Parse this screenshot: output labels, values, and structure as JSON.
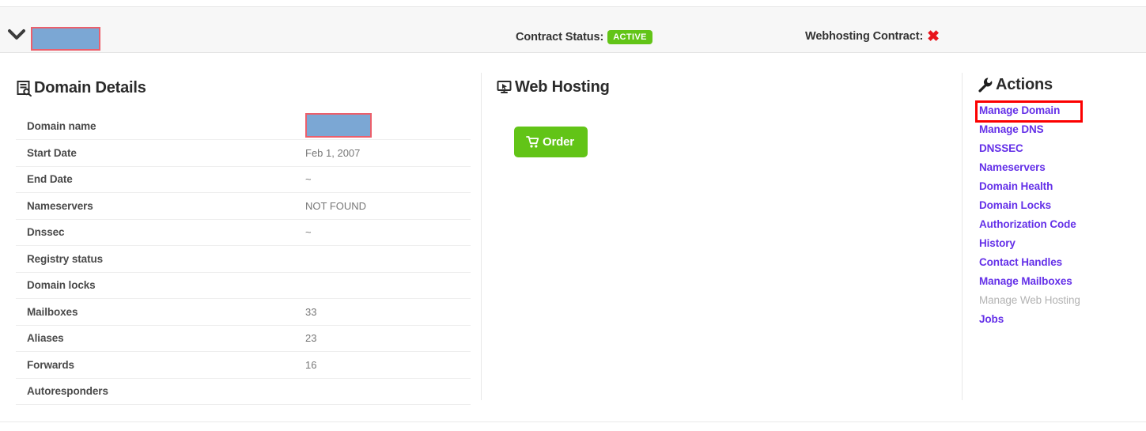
{
  "header": {
    "collapse_icon": "chevron-down-icon",
    "redacted_title": "",
    "contract_status_label": "Contract Status:",
    "contract_status_value": "ACTIVE",
    "webhosting_contract_label": "Webhosting Contract:",
    "webhosting_contract_value": "✖",
    "badge_color": "#62c417",
    "x_color": "#e8131a"
  },
  "domain_details": {
    "icon": "document-search-icon",
    "title": "Domain Details",
    "rows": [
      {
        "label": "Domain name",
        "value": "",
        "redacted": true
      },
      {
        "label": "Start Date",
        "value": "Feb 1, 2007",
        "redacted": false
      },
      {
        "label": "End Date",
        "value": "~",
        "redacted": false
      },
      {
        "label": "Nameservers",
        "value": "NOT FOUND",
        "redacted": false
      },
      {
        "label": "Dnssec",
        "value": "~",
        "redacted": false
      },
      {
        "label": "Registry status",
        "value": "",
        "redacted": false
      },
      {
        "label": "Domain locks",
        "value": "",
        "redacted": false
      },
      {
        "label": "Mailboxes",
        "value": "33",
        "redacted": false
      },
      {
        "label": "Aliases",
        "value": "23",
        "redacted": false
      },
      {
        "label": "Forwards",
        "value": "16",
        "redacted": false
      },
      {
        "label": "Autoresponders",
        "value": "",
        "redacted": false
      }
    ]
  },
  "web_hosting": {
    "icon": "monitor-cursor-icon",
    "title": "Web Hosting",
    "order_button": {
      "label": "Order",
      "icon": "shopping-cart-icon",
      "color": "#62c417"
    }
  },
  "actions": {
    "icon": "wrench-icon",
    "title": "Actions",
    "link_color": "#6430e8",
    "disabled_color": "#b3b3b3",
    "highlight_color": "#fc0000",
    "highlighted_item": "Manage Domain",
    "items": [
      {
        "label": "Manage Domain",
        "disabled": false
      },
      {
        "label": "Manage DNS",
        "disabled": false
      },
      {
        "label": "DNSSEC",
        "disabled": false
      },
      {
        "label": "Nameservers",
        "disabled": false
      },
      {
        "label": "Domain Health",
        "disabled": false
      },
      {
        "label": "Domain Locks",
        "disabled": false
      },
      {
        "label": "Authorization Code",
        "disabled": false
      },
      {
        "label": "History",
        "disabled": false
      },
      {
        "label": "Contact Handles",
        "disabled": false
      },
      {
        "label": "Manage Mailboxes",
        "disabled": false
      },
      {
        "label": "Manage Web Hosting",
        "disabled": true
      },
      {
        "label": "Jobs",
        "disabled": false
      }
    ]
  }
}
